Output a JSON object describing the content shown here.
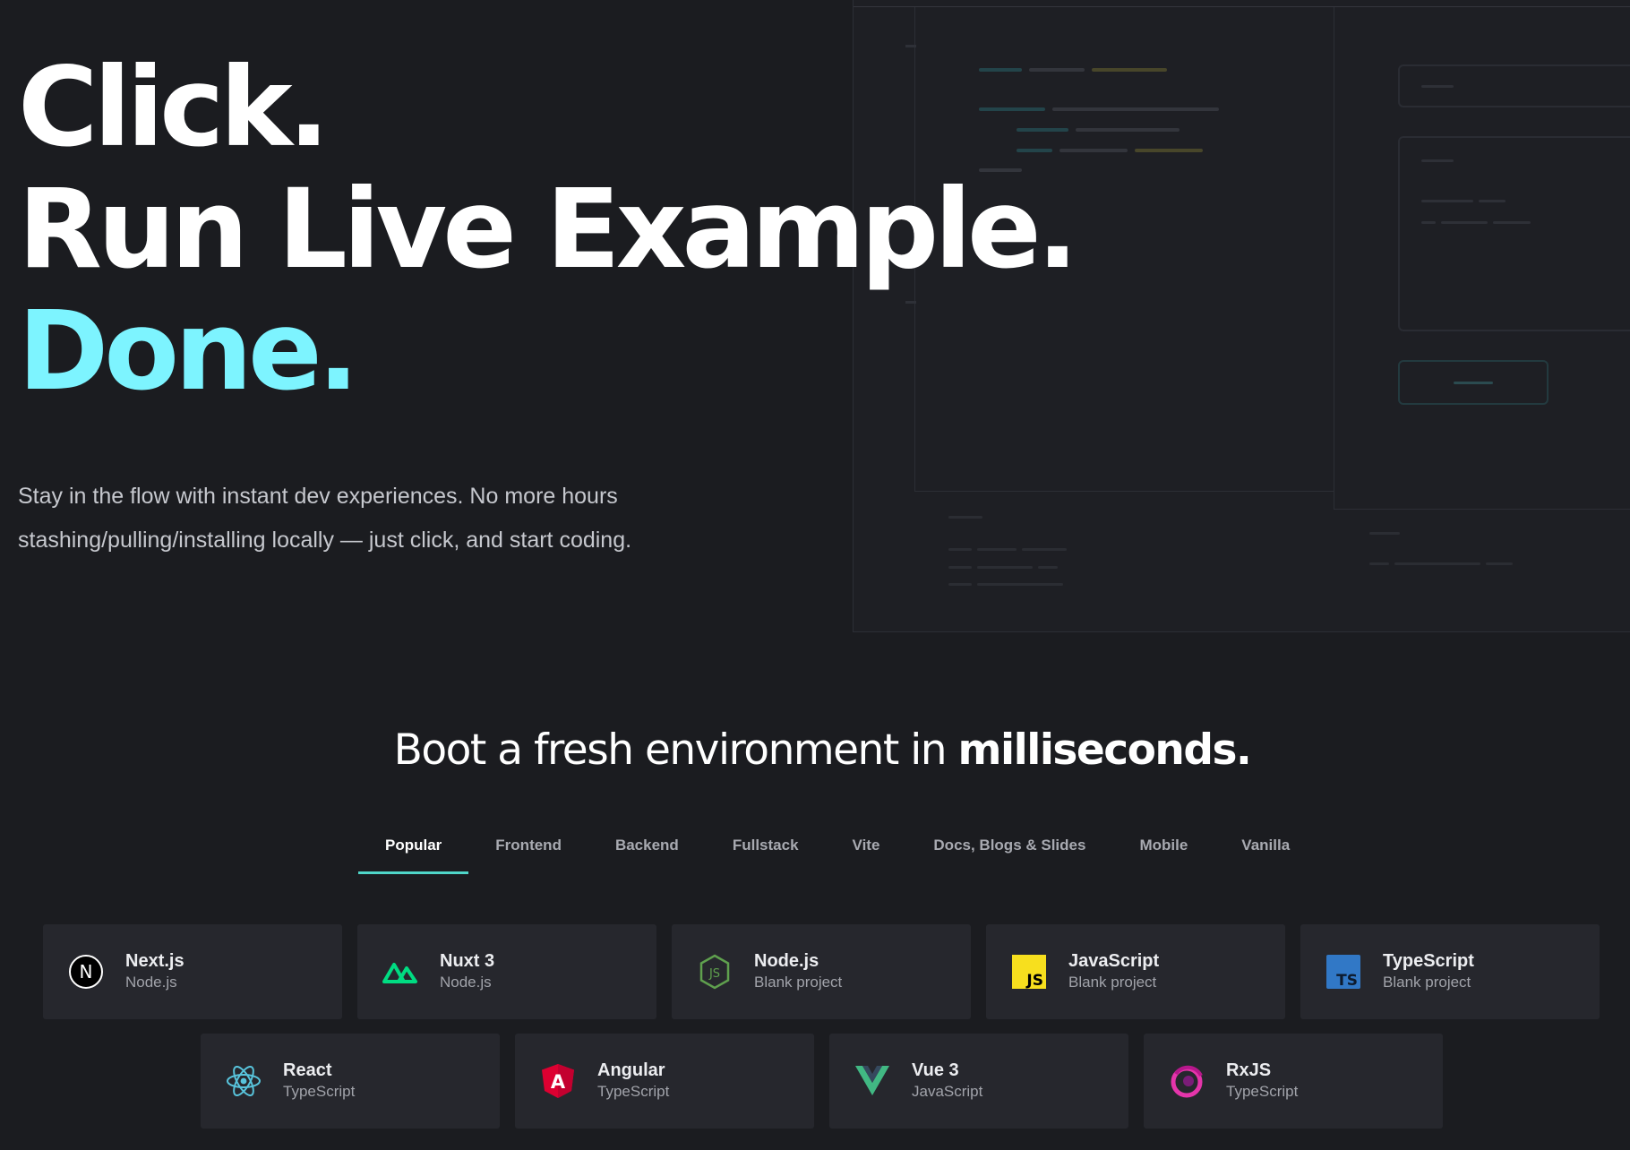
{
  "hero": {
    "line1": "Click.",
    "line2": "Run Live Example.",
    "line3": "Done.",
    "sub_line1": "Stay in the flow with instant dev experiences. No more hours",
    "sub_line2": "stashing/pulling/installing locally — just click, and start coding.",
    "accent_color": "#7df4ff"
  },
  "boot": {
    "title_prefix": "Boot a fresh environment in",
    "title_bold": "milliseconds."
  },
  "tabs": [
    {
      "label": "Popular",
      "active": true
    },
    {
      "label": "Frontend",
      "active": false
    },
    {
      "label": "Backend",
      "active": false
    },
    {
      "label": "Fullstack",
      "active": false
    },
    {
      "label": "Vite",
      "active": false
    },
    {
      "label": "Docs, Blogs & Slides",
      "active": false
    },
    {
      "label": "Mobile",
      "active": false
    },
    {
      "label": "Vanilla",
      "active": false
    }
  ],
  "templates_row1": [
    {
      "name": "Next.js",
      "meta": "Node.js",
      "icon": "nextjs-icon"
    },
    {
      "name": "Nuxt 3",
      "meta": "Node.js",
      "icon": "nuxt-icon"
    },
    {
      "name": "Node.js",
      "meta": "Blank project",
      "icon": "nodejs-icon"
    },
    {
      "name": "JavaScript",
      "meta": "Blank project",
      "icon": "javascript-icon"
    },
    {
      "name": "TypeScript",
      "meta": "Blank project",
      "icon": "typescript-icon"
    }
  ],
  "templates_row2": [
    {
      "name": "React",
      "meta": "TypeScript",
      "icon": "react-icon"
    },
    {
      "name": "Angular",
      "meta": "TypeScript",
      "icon": "angular-icon"
    },
    {
      "name": "Vue 3",
      "meta": "JavaScript",
      "icon": "vue-icon"
    },
    {
      "name": "RxJS",
      "meta": "TypeScript",
      "icon": "rxjs-icon"
    }
  ],
  "icons": {
    "js_label": "JS",
    "ts_label": "TS",
    "next_label": "N",
    "angular_label": "A"
  },
  "colors": {
    "background": "#1b1c20",
    "card": "#26272d",
    "tab_underline": "#4fd6c9",
    "nuxt": "#00dc82",
    "node": "#5fa04e",
    "javascript": "#f7df1e",
    "typescript": "#3178c6",
    "react": "#58c4dc",
    "angular": "#dd0031",
    "vue": "#41b883",
    "rxjs": "#e535ab"
  }
}
